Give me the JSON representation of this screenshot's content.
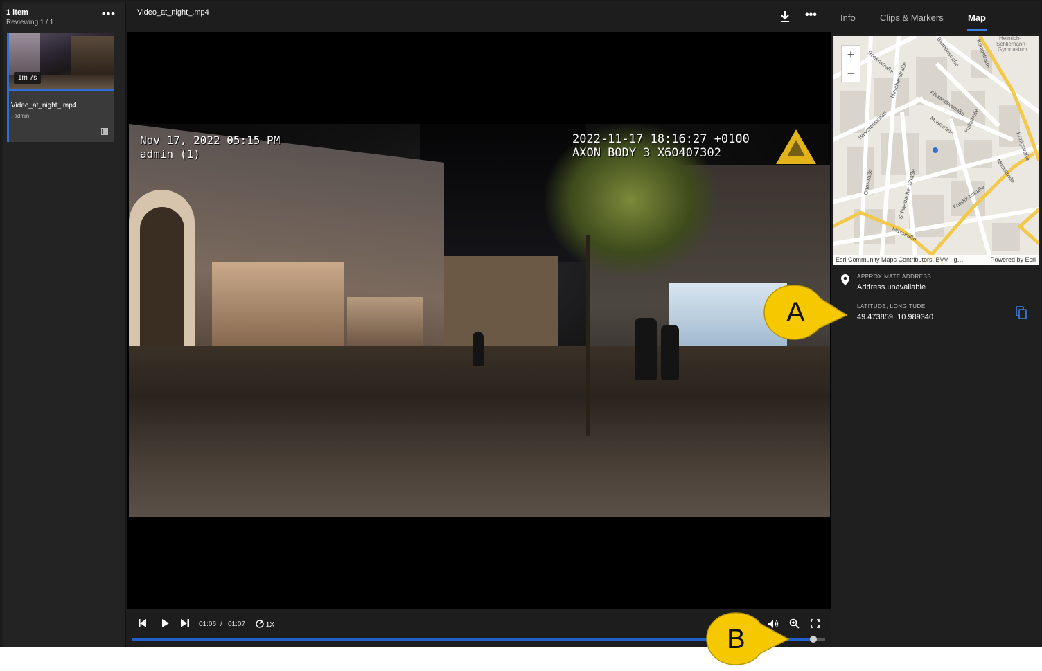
{
  "sidebar": {
    "item_count": "1 item",
    "reviewing": "Reviewing 1 / 1",
    "more_label": "•••",
    "card": {
      "duration": "1m 7s",
      "title": "Video_at_night_.mp4",
      "subtitle": ", admin",
      "type_icon": "film-icon"
    }
  },
  "player": {
    "title": "Video_at_night_.mp4",
    "download_icon": "download-icon",
    "more_label": "•••",
    "osd_left": "Nov 17, 2022 05:15 PM\nadmin (1)",
    "osd_right": "2022-11-17 18:16:27 +0100\nAXON BODY 3 X60407302",
    "controls": {
      "current_time": "01:06",
      "separator": "/",
      "total_time": "01:07",
      "speed": "1X",
      "progress": 0.983
    }
  },
  "right_panel": {
    "tabs": [
      {
        "label": "Info",
        "active": false
      },
      {
        "label": "Clips & Markers",
        "active": false
      },
      {
        "label": "Map",
        "active": true
      }
    ],
    "map": {
      "zoom_in": "+",
      "zoom_out": "−",
      "attribution": "Esri Community Maps Contributors, BVV - g…",
      "powered_by": "Powered by Esri",
      "streets": [
        "Rosenstraße",
        "Hirschenstraße",
        "Alexanderstraße",
        "Königstraße",
        "Moststraße",
        "Hallstraße",
        "Friedrichstraße",
        "Ottostraße",
        "Schwabacher Straße",
        "Maxstraße",
        "Heinrich-Schliemann-Gymnasium"
      ]
    },
    "address_label": "APPROXIMATE ADDRESS",
    "address_value": "Address unavailable",
    "latlng_label": "LATITUDE, LONGITUDE",
    "latlng_value": "49.473859, 10.989340"
  },
  "callouts": {
    "a": "A",
    "b": "B",
    "color": "#f5c800"
  },
  "colors": {
    "accent": "#3b82e8",
    "progress": "#1f61c8"
  }
}
